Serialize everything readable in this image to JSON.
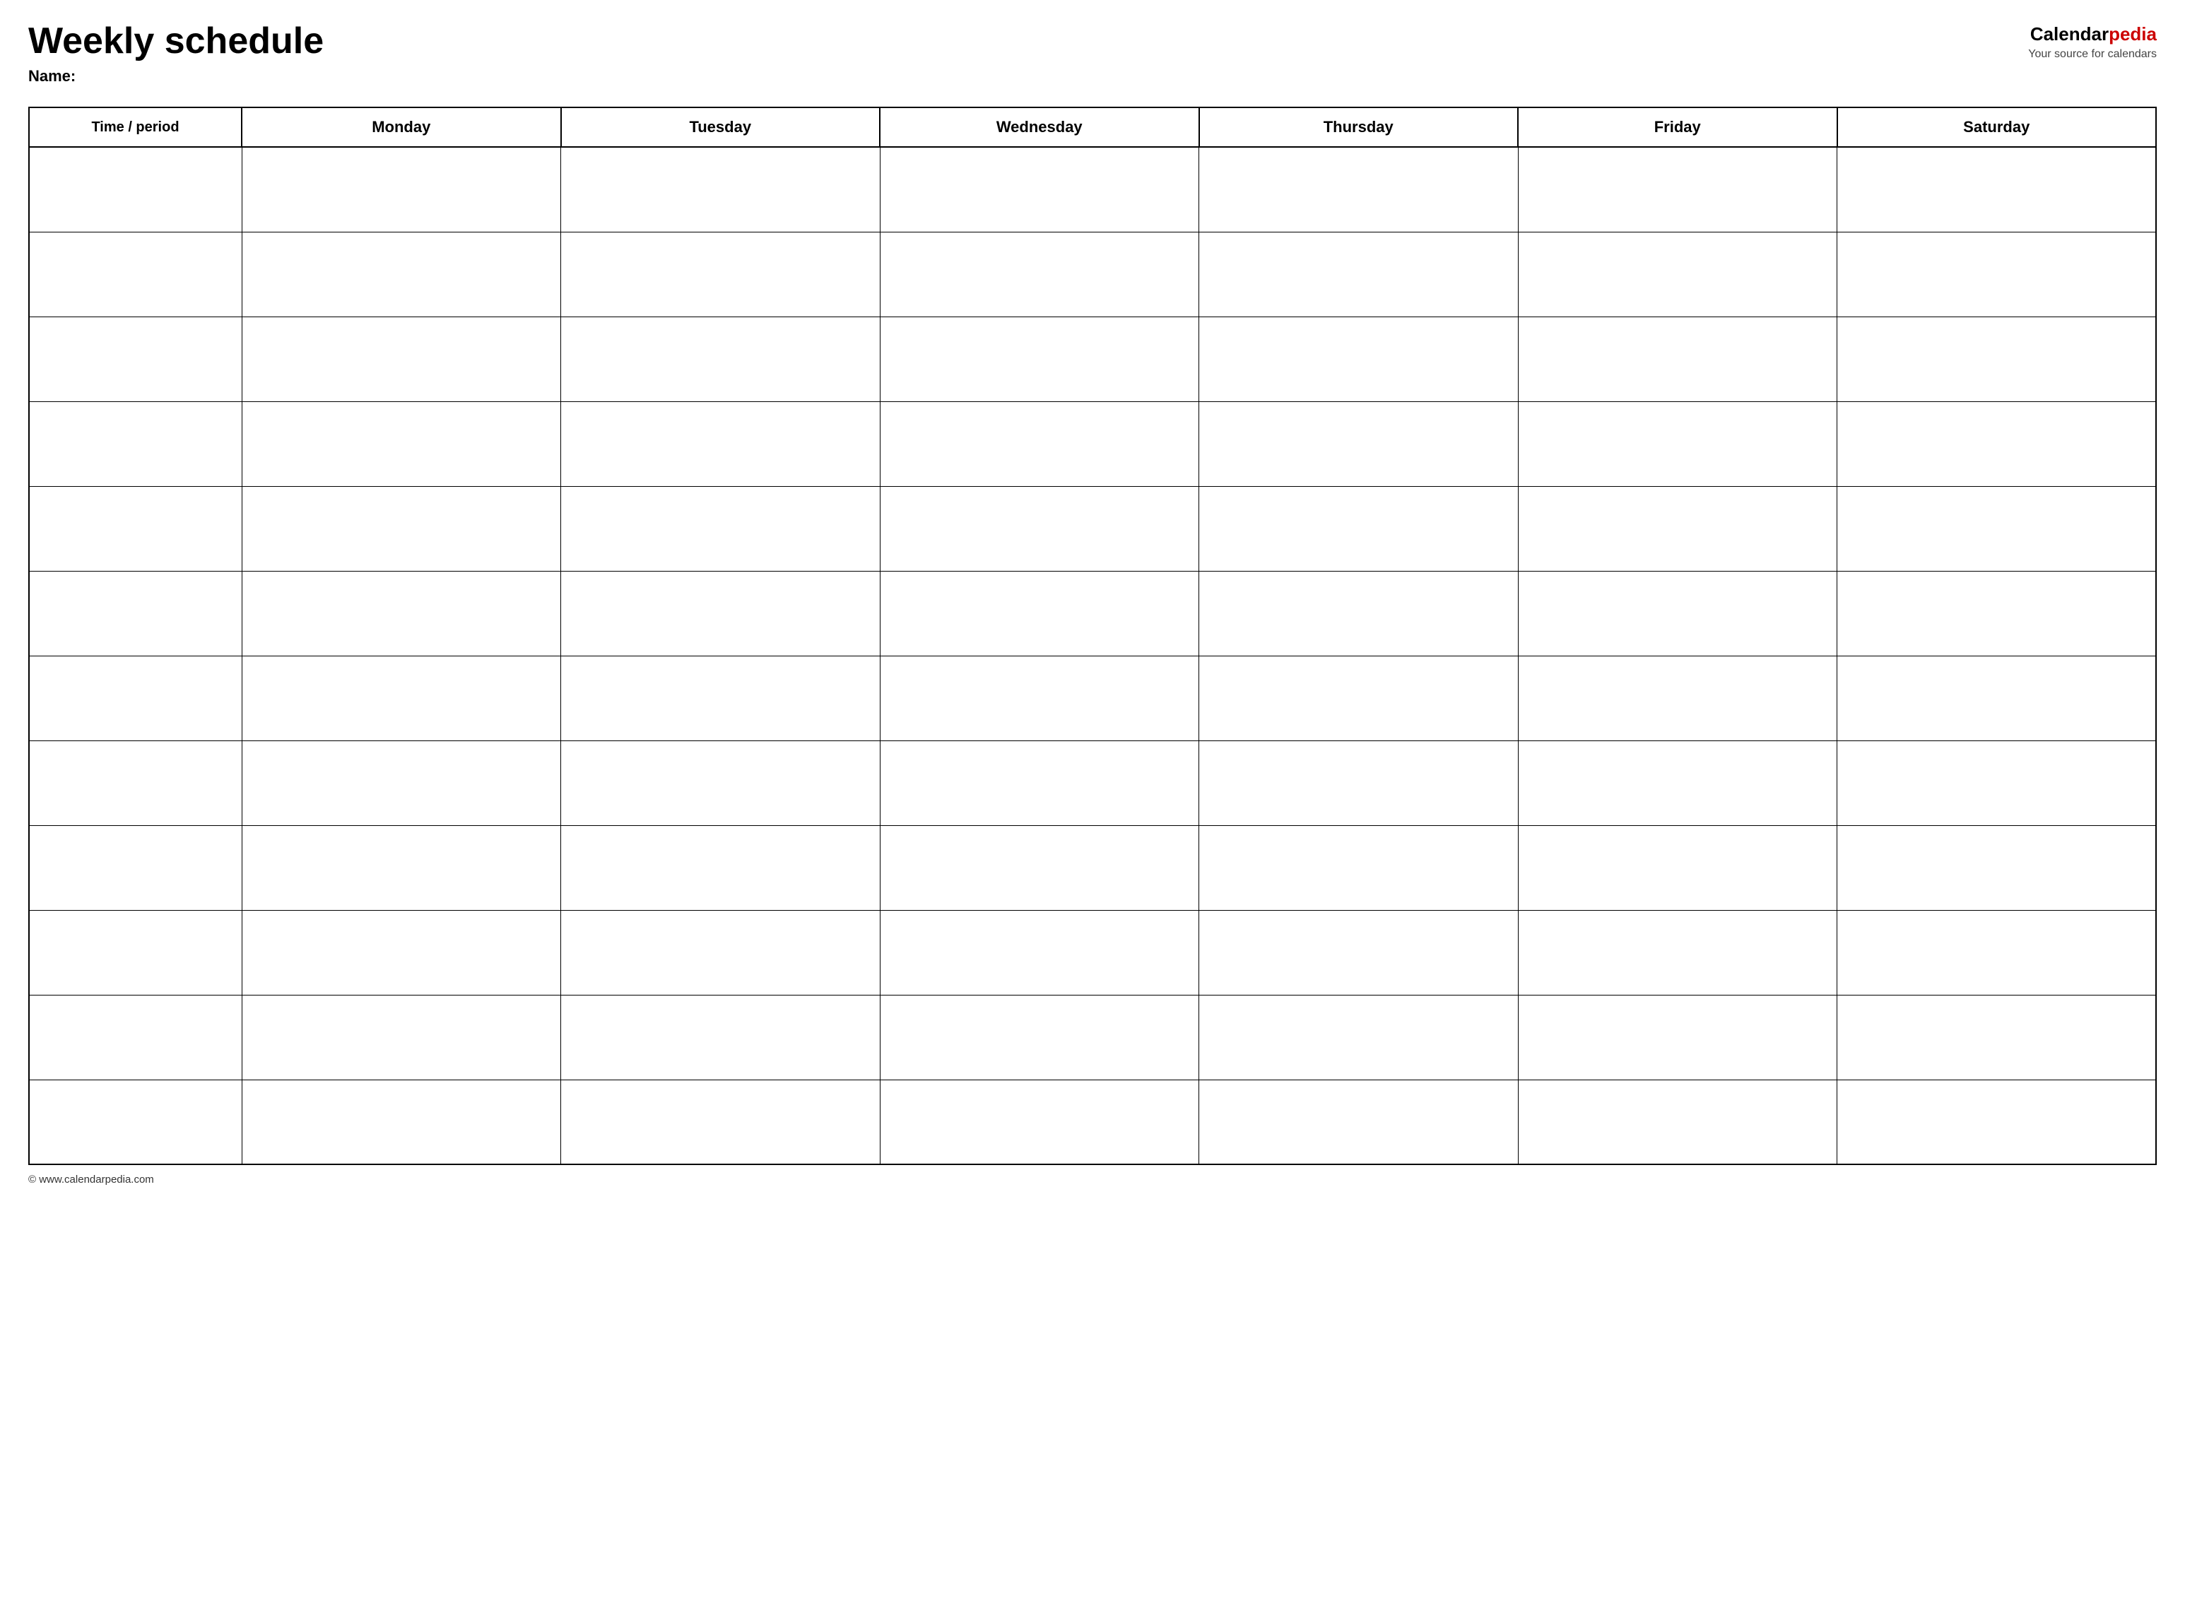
{
  "page": {
    "title": "Weekly schedule",
    "name_label": "Name:",
    "footer_text": "© www.calendarpedia.com"
  },
  "logo": {
    "calendar_text": "Calendar",
    "pedia_text": "pedia",
    "tagline": "Your source for calendars"
  },
  "table": {
    "headers": [
      {
        "id": "time",
        "label": "Time / period"
      },
      {
        "id": "monday",
        "label": "Monday"
      },
      {
        "id": "tuesday",
        "label": "Tuesday"
      },
      {
        "id": "wednesday",
        "label": "Wednesday"
      },
      {
        "id": "thursday",
        "label": "Thursday"
      },
      {
        "id": "friday",
        "label": "Friday"
      },
      {
        "id": "saturday",
        "label": "Saturday"
      }
    ],
    "row_count": 12
  }
}
